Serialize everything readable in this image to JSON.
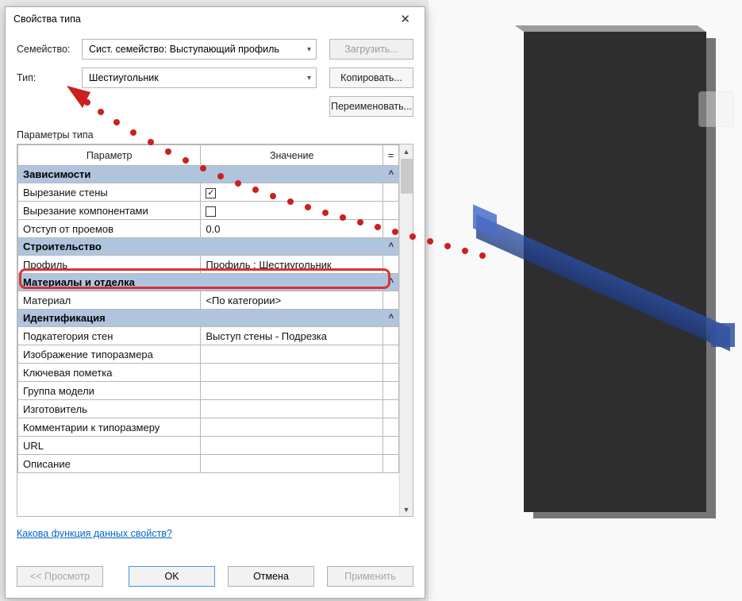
{
  "dialog": {
    "title": "Свойства типа",
    "family_label": "Семейство:",
    "family_value": "Сист. семейство: Выступающий профиль",
    "type_label": "Тип:",
    "type_value": "Шестиугольник",
    "btn_load": "Загрузить...",
    "btn_copy": "Копировать...",
    "btn_rename": "Переименовать...",
    "params_label": "Параметры типа",
    "col_param": "Параметр",
    "col_value": "Значение",
    "col_eq": "=",
    "groups": {
      "deps": "Зависимости",
      "constr": "Строительство",
      "mat": "Материалы и отделка",
      "ident": "Идентификация"
    },
    "rows": {
      "cut_wall": {
        "p": "Вырезание стены",
        "v_checked": true
      },
      "cut_comp": {
        "p": "Вырезание компонентами",
        "v_checked": false
      },
      "offset": {
        "p": "Отступ от проемов",
        "v": "0.0"
      },
      "profile": {
        "p": "Профиль",
        "v": "Профиль : Шестиугольник"
      },
      "material": {
        "p": "Материал",
        "v": "<По категории>"
      },
      "subcat": {
        "p": "Подкатегория стен",
        "v": "Выступ стены - Подрезка"
      },
      "typeimg": {
        "p": "Изображение типоразмера",
        "v": ""
      },
      "keynote": {
        "p": "Ключевая пометка",
        "v": ""
      },
      "modelgrp": {
        "p": "Группа модели",
        "v": ""
      },
      "manuf": {
        "p": "Изготовитель",
        "v": ""
      },
      "typecomm": {
        "p": "Комментарии к типоразмеру",
        "v": ""
      },
      "url": {
        "p": "URL",
        "v": ""
      },
      "descr": {
        "p": "Описание",
        "v": ""
      }
    },
    "help_link": "Какова функция данных свойств?",
    "btn_preview": "<< Просмотр",
    "btn_ok": "OK",
    "btn_cancel": "Отмена",
    "btn_apply": "Применить"
  }
}
